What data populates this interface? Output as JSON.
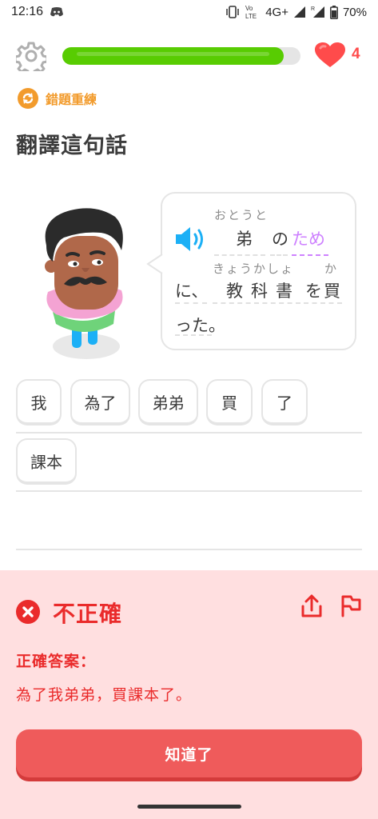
{
  "status_bar": {
    "time": "12:16",
    "network": "4G+",
    "battery": "70%",
    "icons": [
      "discord-icon",
      "vibrate-icon",
      "volte-icon",
      "signal-icon",
      "battery-icon"
    ]
  },
  "lesson": {
    "progress": 0.93,
    "hearts": "4",
    "review_label": "錯題重練",
    "prompt": "翻譯這句話"
  },
  "sentence": {
    "line1": {
      "ruby": "おとうと",
      "word1": "弟",
      "word2": "の",
      "word3": "ため"
    },
    "line2": {
      "ruby1": "きょうかしょ",
      "ruby2": "か",
      "ni": "に、",
      "kyokasho": "教科書",
      "wo": "を",
      "ka": "買"
    },
    "line3": "った。"
  },
  "answer_tiles": [
    "我",
    "為了",
    "弟弟",
    "買",
    "了",
    "課本"
  ],
  "feedback": {
    "title": "不正確",
    "correct_label": "正確答案：",
    "correct_answer": "為了我弟弟，買課本了。",
    "continue_label": "知道了"
  },
  "colors": {
    "green": "#58cc02",
    "red": "#ea2b2b",
    "purple": "#ce82ff",
    "orange": "#f29b2c",
    "blue": "#1cb0f6"
  }
}
